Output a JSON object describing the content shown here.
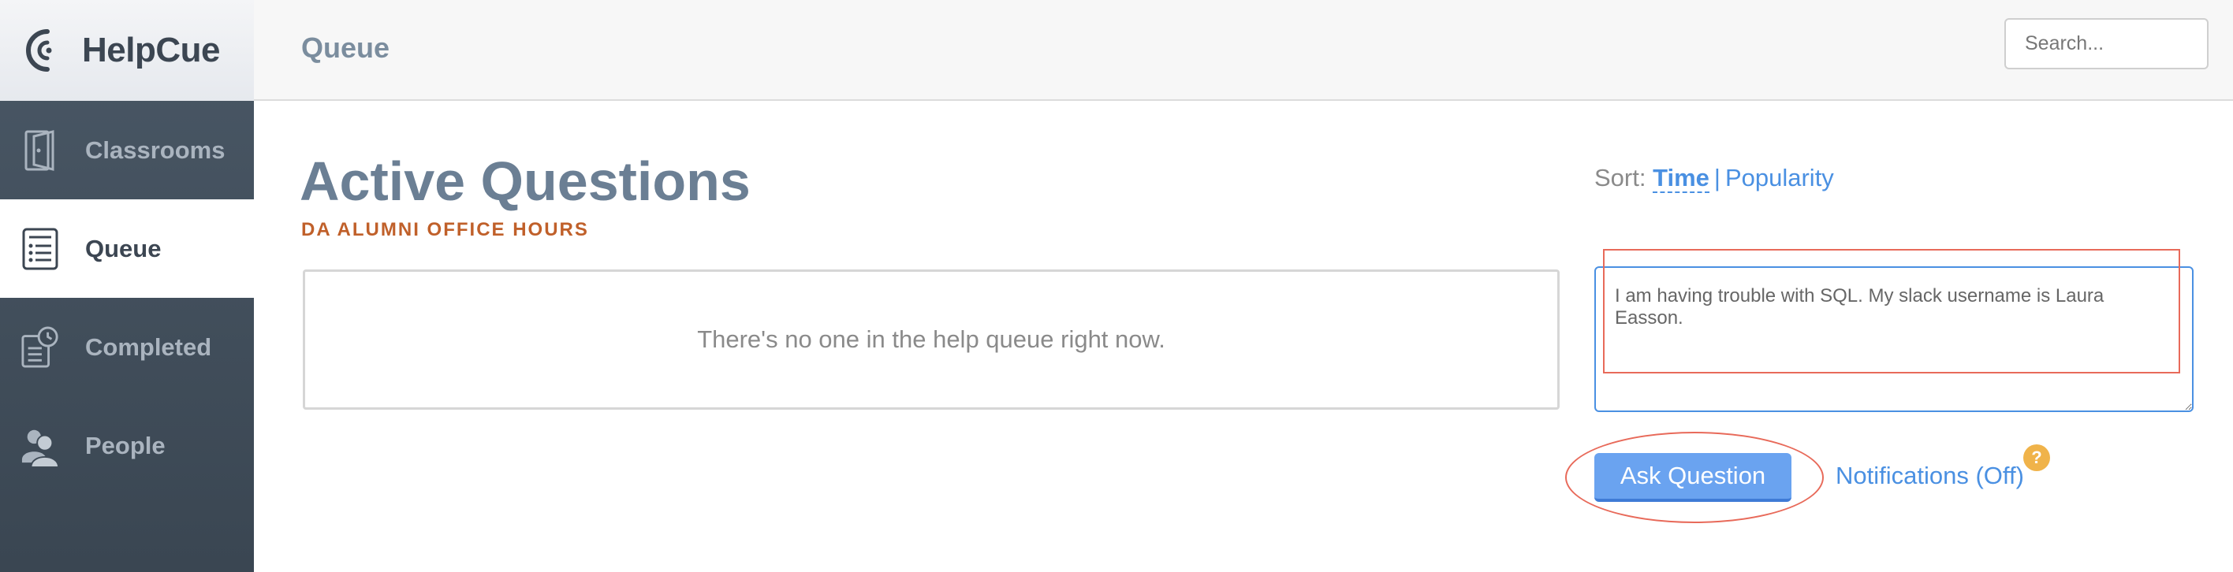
{
  "app": {
    "name": "HelpCue"
  },
  "sidebar": {
    "items": [
      {
        "label": "Classrooms",
        "icon": "classroom-door-icon",
        "active": false
      },
      {
        "label": "Queue",
        "icon": "list-icon",
        "active": true
      },
      {
        "label": "Completed",
        "icon": "clock-list-icon",
        "active": false
      },
      {
        "label": "People",
        "icon": "people-icon",
        "active": false
      }
    ]
  },
  "topbar": {
    "title": "Queue",
    "search_placeholder": "Search..."
  },
  "main": {
    "title": "Active Questions",
    "subtitle": "DA ALUMNI OFFICE HOURS",
    "empty_message": "There's no one in the help queue right now."
  },
  "sort": {
    "label": "Sort:",
    "options": [
      "Time",
      "Popularity"
    ],
    "active": "Time",
    "separator": "|"
  },
  "question_form": {
    "text": "I am having trouble with SQL. My slack username is Laura Easson.",
    "submit_label": "Ask Question",
    "notifications_label": "Notifications (Off)",
    "help_badge": "?"
  },
  "colors": {
    "accent": "#4a90e2",
    "sidebar": "#3e4a56",
    "subtitle": "#c0602a",
    "highlight": "#e86a5a"
  }
}
